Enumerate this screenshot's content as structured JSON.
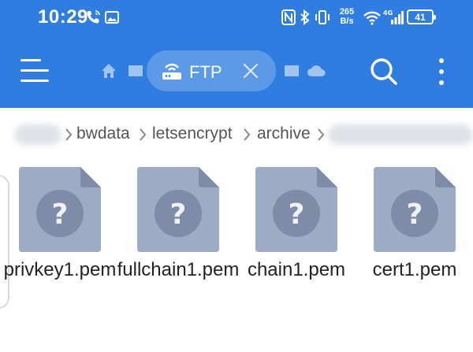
{
  "status_bar": {
    "time": "10:29",
    "net_speed_value": "265",
    "net_speed_unit": "B/s",
    "battery": "41",
    "icons": [
      "wifi-calling-icon",
      "gallery-icon",
      "nfc-icon",
      "bluetooth-icon",
      "vibrate-icon",
      "wifi-icon",
      "cellular-4g-icon",
      "battery-icon"
    ]
  },
  "toolbar": {
    "menu_icon": "hamburger-menu-icon",
    "tab_label": "FTP",
    "tab_icon": "ftp-router-icon",
    "search_icon": "search-icon",
    "more_icon": "more-vertical-icon"
  },
  "breadcrumb": {
    "items": [
      "bwdata",
      "letsencrypt",
      "archive"
    ]
  },
  "files": [
    {
      "name": "privkey1.pem",
      "icon": "unknown-file-icon"
    },
    {
      "name": "fullchain1.pem",
      "icon": "unknown-file-icon"
    },
    {
      "name": "chain1.pem",
      "icon": "unknown-file-icon"
    },
    {
      "name": "cert1.pem",
      "icon": "unknown-file-icon"
    }
  ],
  "colors": {
    "app_bar": "#2f7de1",
    "file_icon": "#9eabc4",
    "file_icon_fold": "#7e8ca8",
    "file_icon_circle": "#7e8ca8"
  }
}
